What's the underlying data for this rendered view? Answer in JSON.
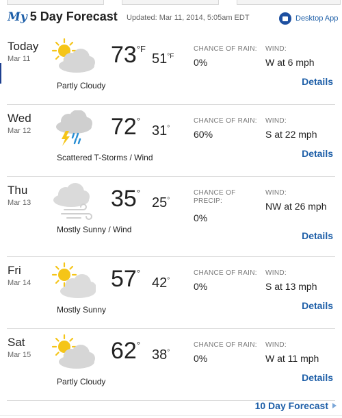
{
  "header": {
    "logo_my": "My",
    "title": "5 Day Forecast",
    "updated": "Updated: Mar 11, 2014, 5:05am EDT",
    "desktop_label": "Desktop App"
  },
  "days": [
    {
      "day": "Today",
      "date": "Mar 11",
      "icon": "partly-cloudy-icon",
      "condition": "Partly Cloudy",
      "high": "73",
      "high_unit": "°F",
      "low": "51",
      "low_unit": "°F",
      "precip_label": "CHANCE OF RAIN:",
      "precip_value": "0%",
      "wind_label": "WIND:",
      "wind_value": "W at 6 mph",
      "details": "Details"
    },
    {
      "day": "Wed",
      "date": "Mar 12",
      "icon": "thunderstorm-icon",
      "condition": "Scattered T-Storms / Wind",
      "high": "72",
      "high_unit": "°",
      "low": "31",
      "low_unit": "°",
      "precip_label": "CHANCE OF RAIN:",
      "precip_value": "60%",
      "wind_label": "WIND:",
      "wind_value": "S at 22 mph",
      "details": "Details"
    },
    {
      "day": "Thu",
      "date": "Mar 13",
      "icon": "cloud-wind-icon",
      "condition": "Mostly Sunny / Wind",
      "high": "35",
      "high_unit": "°",
      "low": "25",
      "low_unit": "°",
      "precip_label": "CHANCE OF PRECIP:",
      "precip_value": "0%",
      "wind_label": "WIND:",
      "wind_value": "NW at 26 mph",
      "details": "Details"
    },
    {
      "day": "Fri",
      "date": "Mar 14",
      "icon": "mostly-sunny-icon",
      "condition": "Mostly Sunny",
      "high": "57",
      "high_unit": "°",
      "low": "42",
      "low_unit": "°",
      "precip_label": "CHANCE OF RAIN:",
      "precip_value": "0%",
      "wind_label": "WIND:",
      "wind_value": "S at 13 mph",
      "details": "Details"
    },
    {
      "day": "Sat",
      "date": "Mar 15",
      "icon": "partly-cloudy-icon",
      "condition": "Partly Cloudy",
      "high": "62",
      "high_unit": "°",
      "low": "38",
      "low_unit": "°",
      "precip_label": "CHANCE OF RAIN:",
      "precip_value": "0%",
      "wind_label": "WIND:",
      "wind_value": "W at 11 mph",
      "details": "Details"
    }
  ],
  "footer": {
    "ten_day": "10 Day Forecast"
  },
  "colors": {
    "link": "#1e5fa8",
    "sun": "#f5c518",
    "cloud": "#d4d4d4",
    "rain": "#2a8fd4"
  }
}
